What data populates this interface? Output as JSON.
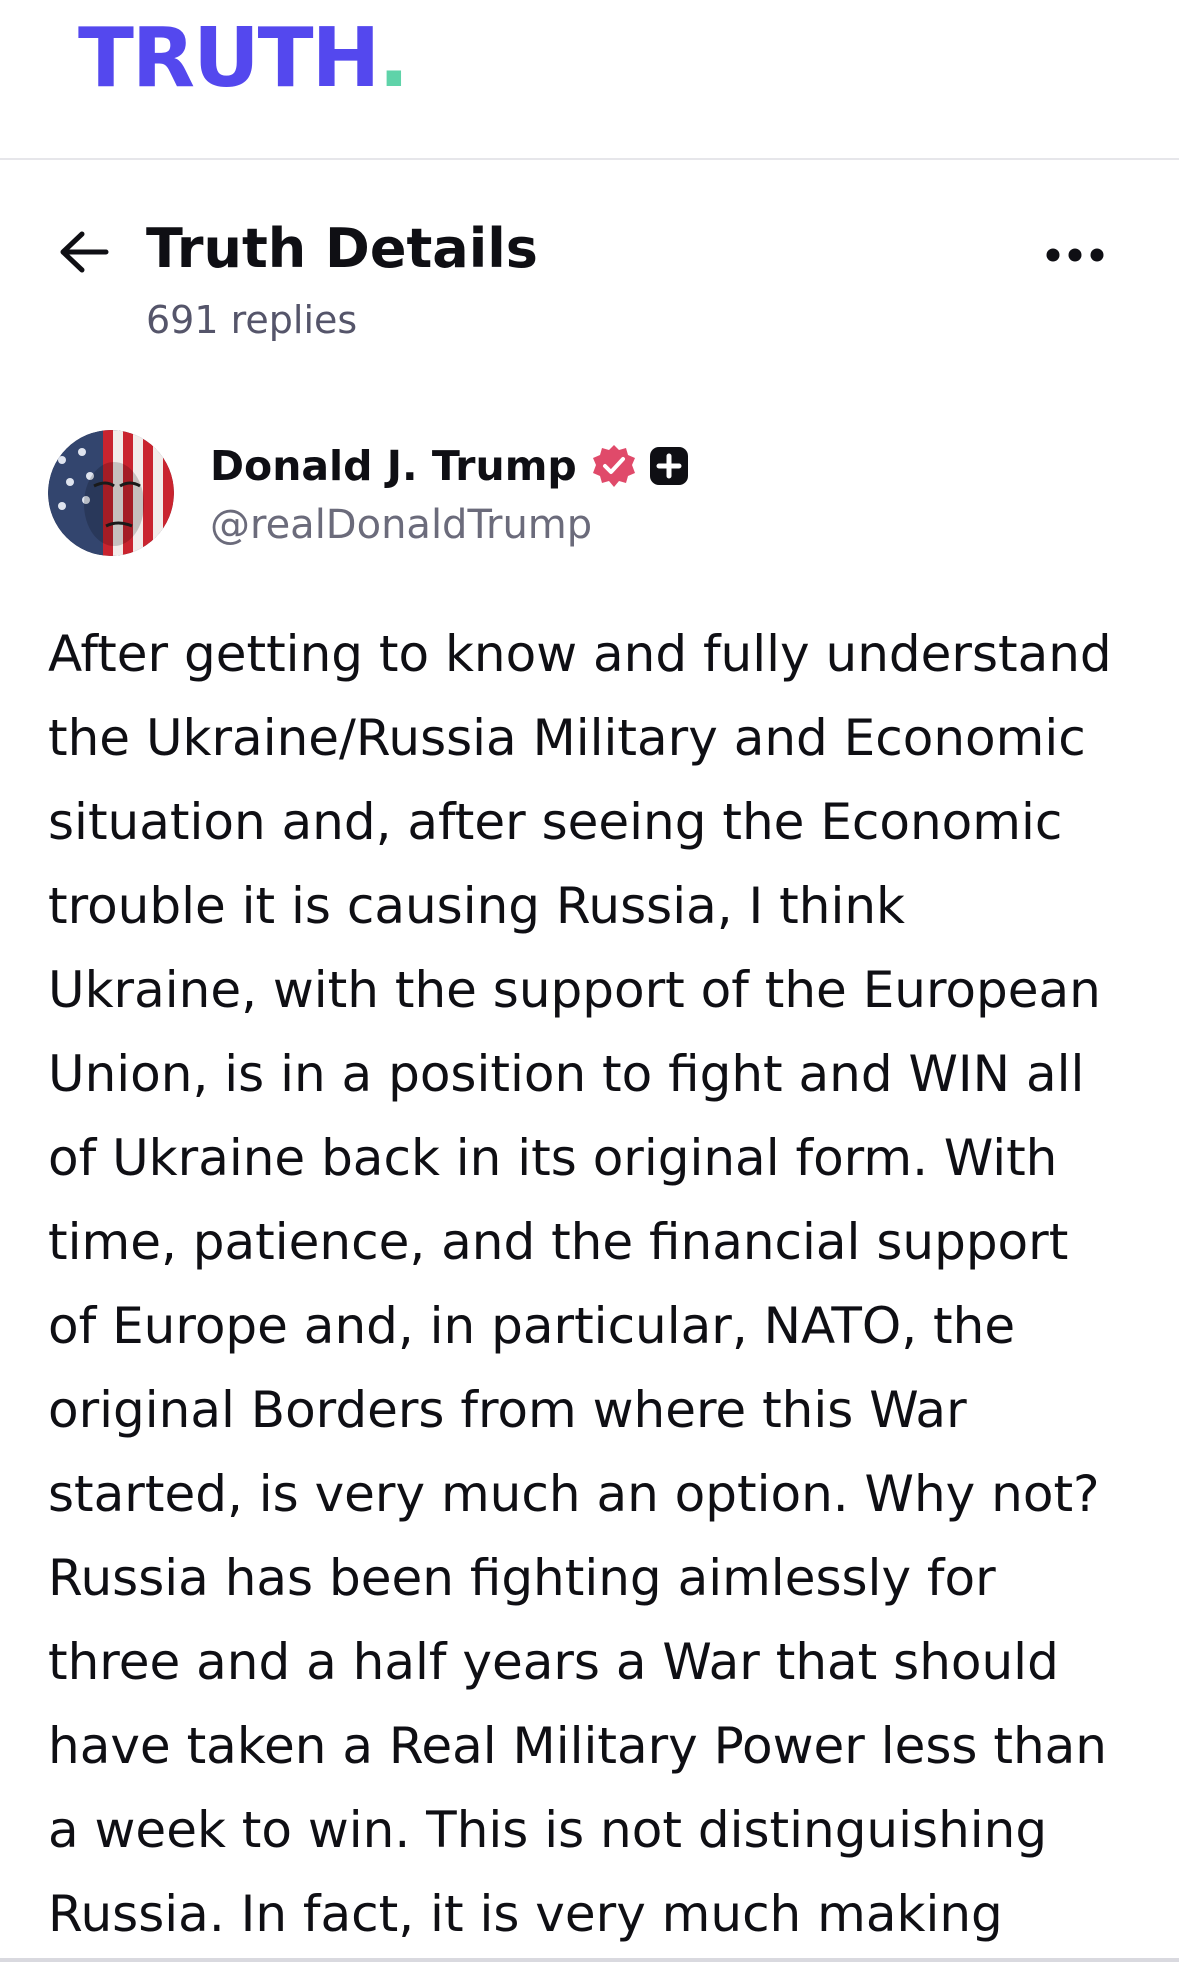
{
  "app": {
    "logo_text": "TRUTH",
    "logo_dot": ".",
    "brand_color": "#5448ee",
    "accent_color": "#5fd3a9"
  },
  "header": {
    "back_icon": "arrow-left-icon",
    "title": "Truth Details",
    "replies": "691 replies",
    "more_icon": "more-horizontal-icon"
  },
  "author": {
    "name": "Donald J. Trump",
    "handle": "@realDonaldTrump",
    "verified_icon": "verified-badge-icon",
    "verified_color": "#e04a6a",
    "plus_icon": "plus-badge-icon"
  },
  "post": {
    "lines": [
      "After getting to know and fully understand",
      "the Ukraine/Russia Military and Economic",
      "situation and, after seeing the Economic",
      "trouble it is causing Russia, I think",
      "Ukraine, with the support of the European",
      "Union, is in a position to fight and WIN all",
      "of Ukraine back in its original form. With",
      "time, patience, and the financial support",
      "of Europe and, in particular, NATO, the",
      "original Borders from where this War",
      "started, is very much an option. Why not?",
      "Russia has been fighting aimlessly for",
      "three and a half years a War that should",
      "have taken a Real Military Power less than",
      "a week to win. This is not distinguishing",
      "Russia. In fact, it is very much making"
    ]
  }
}
